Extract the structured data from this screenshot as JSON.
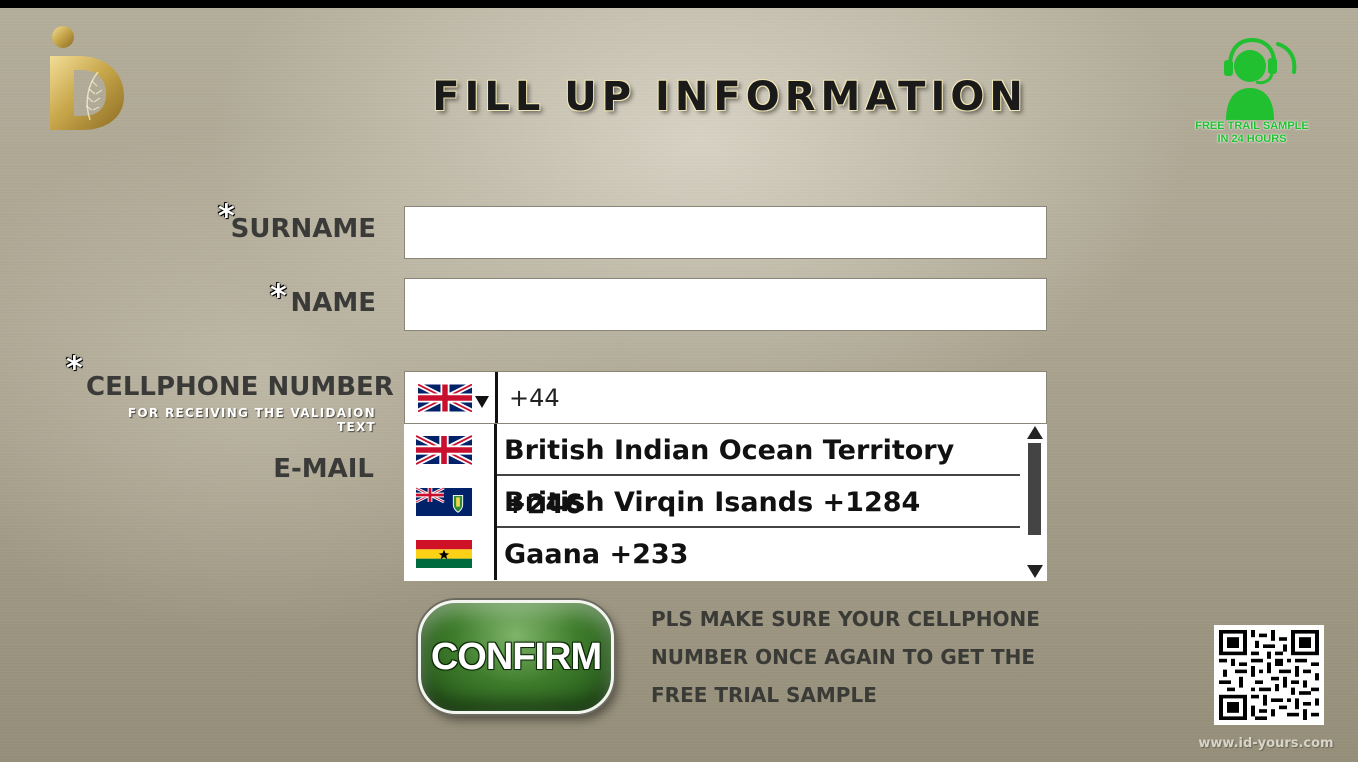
{
  "page": {
    "title": "FILL UP INFORMATION"
  },
  "support_badge": {
    "line1": "FREE TRAIL SAMPLE",
    "line2": "IN 24 HOURS",
    "icon": "headset-agent-icon",
    "color": "#20c030"
  },
  "form": {
    "required_mark": "*",
    "surname": {
      "label": "SURNAME",
      "value": ""
    },
    "name": {
      "label": "NAME",
      "value": ""
    },
    "cellphone": {
      "label": "CELLPHONE NUMBER",
      "note": "FOR RECEIVING THE VALIDAION TEXT",
      "selected_flag": "uk-flag-icon",
      "value": "+44"
    },
    "email": {
      "label": "E-MAIL",
      "value": ""
    }
  },
  "country_dropdown": {
    "options": [
      {
        "label": "British Indian Ocean Territory +246",
        "flag": "uk-flag-icon"
      },
      {
        "label": "British Virqin Isands +1284",
        "flag": "bvi-flag-icon"
      },
      {
        "label": "Gaana +233",
        "flag": "ghana-flag-icon"
      }
    ]
  },
  "confirm_button": {
    "label": "CONFIRM"
  },
  "notice": {
    "lines": [
      "PLS MAKE SURE YOUR CELLPHONE",
      "NUMBER ONCE AGAIN TO GET THE",
      "FREE TRIAL SAMPLE"
    ]
  },
  "footer": {
    "website": "www.id-yours.com"
  },
  "colors": {
    "accent_green": "#3f7d2c",
    "logo_gold": "#c9a84c"
  }
}
